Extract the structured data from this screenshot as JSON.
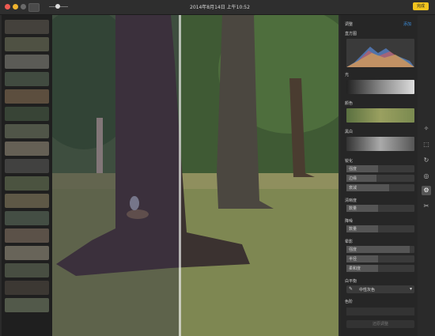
{
  "window": {
    "title": "2014年8月14日 上午10:52",
    "done_label": "完成"
  },
  "panel": {
    "header": "调整",
    "add_label": "添加",
    "histogram_label": "直方图",
    "light_label": "光",
    "color_label": "颜色",
    "bw_label": "黑白",
    "sharpen": {
      "label": "锐化",
      "rows": [
        "强度",
        "边缘",
        "衰减"
      ]
    },
    "definition": {
      "label": "清晰度",
      "rows": [
        "数量"
      ]
    },
    "noise": {
      "label": "降噪",
      "rows": [
        "数量"
      ]
    },
    "vignette": {
      "label": "晕影",
      "rows": [
        "强度",
        "半径",
        "柔和度"
      ]
    },
    "white_balance": {
      "label": "白平衡",
      "select_value": "中性灰色"
    },
    "levels": {
      "label": "色阶"
    },
    "reset_label": "还原调整"
  },
  "colors": {
    "accent": "#f2c41e",
    "link": "#3c8ddb"
  }
}
